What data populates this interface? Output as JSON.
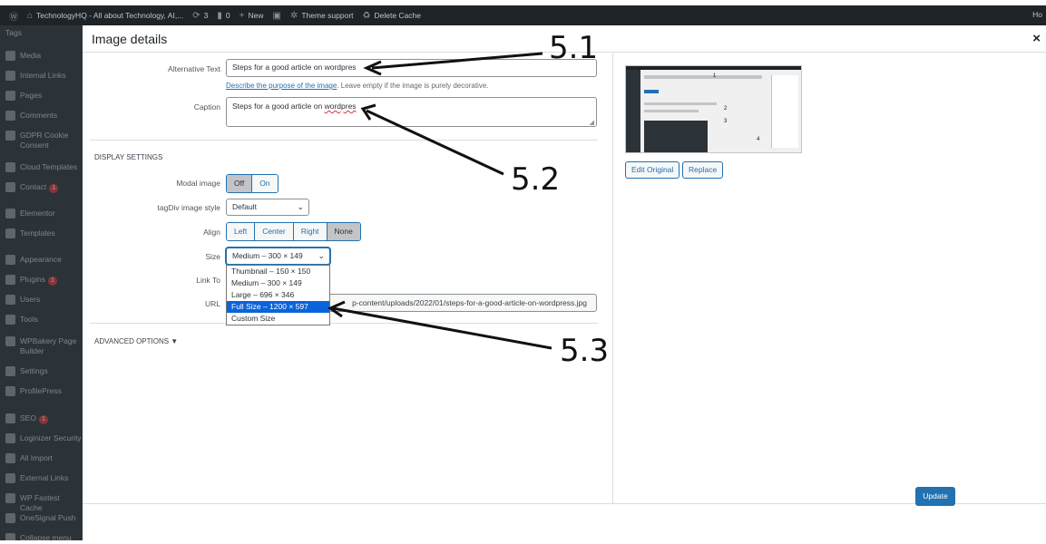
{
  "admin_bar": {
    "site_title": "TechnologyHQ - All about Technology, AI,...",
    "updates_count": "3",
    "comments_count": "0",
    "new_label": "New",
    "theme_support": "Theme support",
    "delete_cache": "Delete Cache",
    "right_text": "Ho"
  },
  "sidebar": {
    "items": [
      {
        "label": "Tags",
        "icon": "none",
        "badge": ""
      },
      {
        "label": "Media",
        "icon": "media-icon",
        "badge": ""
      },
      {
        "label": "Internal Links",
        "icon": "link-icon",
        "badge": ""
      },
      {
        "label": "Pages",
        "icon": "pages-icon",
        "badge": ""
      },
      {
        "label": "Comments",
        "icon": "comments-icon",
        "badge": ""
      },
      {
        "label": "GDPR Cookie Consent",
        "icon": "cookie-icon",
        "badge": ""
      },
      {
        "label": "Cloud Templates",
        "icon": "cloud-icon",
        "badge": ""
      },
      {
        "label": "Contact",
        "icon": "mail-icon",
        "badge": "1"
      },
      {
        "label": "Elementor",
        "icon": "elementor-icon",
        "badge": ""
      },
      {
        "label": "Templates",
        "icon": "folder-icon",
        "badge": ""
      },
      {
        "label": "Appearance",
        "icon": "brush-icon",
        "badge": ""
      },
      {
        "label": "Plugins",
        "icon": "plugin-icon",
        "badge": "1"
      },
      {
        "label": "Users",
        "icon": "user-icon",
        "badge": ""
      },
      {
        "label": "Tools",
        "icon": "wrench-icon",
        "badge": ""
      },
      {
        "label": "WPBakery Page Builder",
        "icon": "builder-icon",
        "badge": ""
      },
      {
        "label": "Settings",
        "icon": "settings-icon",
        "badge": ""
      },
      {
        "label": "ProfilePress",
        "icon": "profile-icon",
        "badge": ""
      },
      {
        "label": "SEO",
        "icon": "seo-icon",
        "badge": "1"
      },
      {
        "label": "Loginizer Security",
        "icon": "lock-icon",
        "badge": ""
      },
      {
        "label": "All Import",
        "icon": "import-icon",
        "badge": ""
      },
      {
        "label": "External Links",
        "icon": "external-link-icon",
        "badge": ""
      },
      {
        "label": "WP Fastest Cache",
        "icon": "cache-icon",
        "badge": ""
      },
      {
        "label": "OneSignal Push",
        "icon": "bell-icon",
        "badge": ""
      },
      {
        "label": "Collapse menu",
        "icon": "collapse-icon",
        "badge": ""
      }
    ]
  },
  "modal": {
    "title": "Image details",
    "close_symbol": "×",
    "alt_text": {
      "label": "Alternative Text",
      "value": "Steps for a good article on wordpres",
      "hint_link": "Describe the purpose of the image",
      "hint_rest": ". Leave empty if the image is purely decorative."
    },
    "caption": {
      "label": "Caption",
      "value_prefix": "Steps for a good article on ",
      "value_misspelled": "wordpres"
    },
    "display_settings_title": "DISPLAY SETTINGS",
    "modal_image": {
      "label": "Modal image",
      "options": [
        "Off",
        "On"
      ],
      "active": "Off"
    },
    "tagdiv_style": {
      "label": "tagDiv image style",
      "value": "Default"
    },
    "align": {
      "label": "Align",
      "options": [
        "Left",
        "Center",
        "Right",
        "None"
      ],
      "active": "None"
    },
    "size": {
      "label": "Size",
      "value": "Medium – 300 × 149",
      "options": [
        "Thumbnail – 150 × 150",
        "Medium – 300 × 149",
        "Large – 696 × 346",
        "Full Size – 1200 × 597",
        "Custom Size"
      ],
      "highlighted": "Full Size – 1200 × 597"
    },
    "link_to": {
      "label": "Link To"
    },
    "url": {
      "label": "URL",
      "value": "p-content/uploads/2022/01/steps-for-a-good-article-on-wordpress.jpg"
    },
    "advanced_options": "ADVANCED OPTIONS ▼",
    "edit_original": "Edit Original",
    "replace": "Replace",
    "update": "Update"
  },
  "annotations": {
    "a1": "5.1",
    "a2": "5.2",
    "a3": "5.3"
  },
  "thumbnail_annotations": [
    "1",
    "2",
    "3",
    "4"
  ],
  "colors": {
    "admin_dark": "#1d2327",
    "sidebar": "#2c3338",
    "primary_blue": "#2271b1",
    "highlight": "#0a64d9",
    "badge_red": "#d63638"
  }
}
